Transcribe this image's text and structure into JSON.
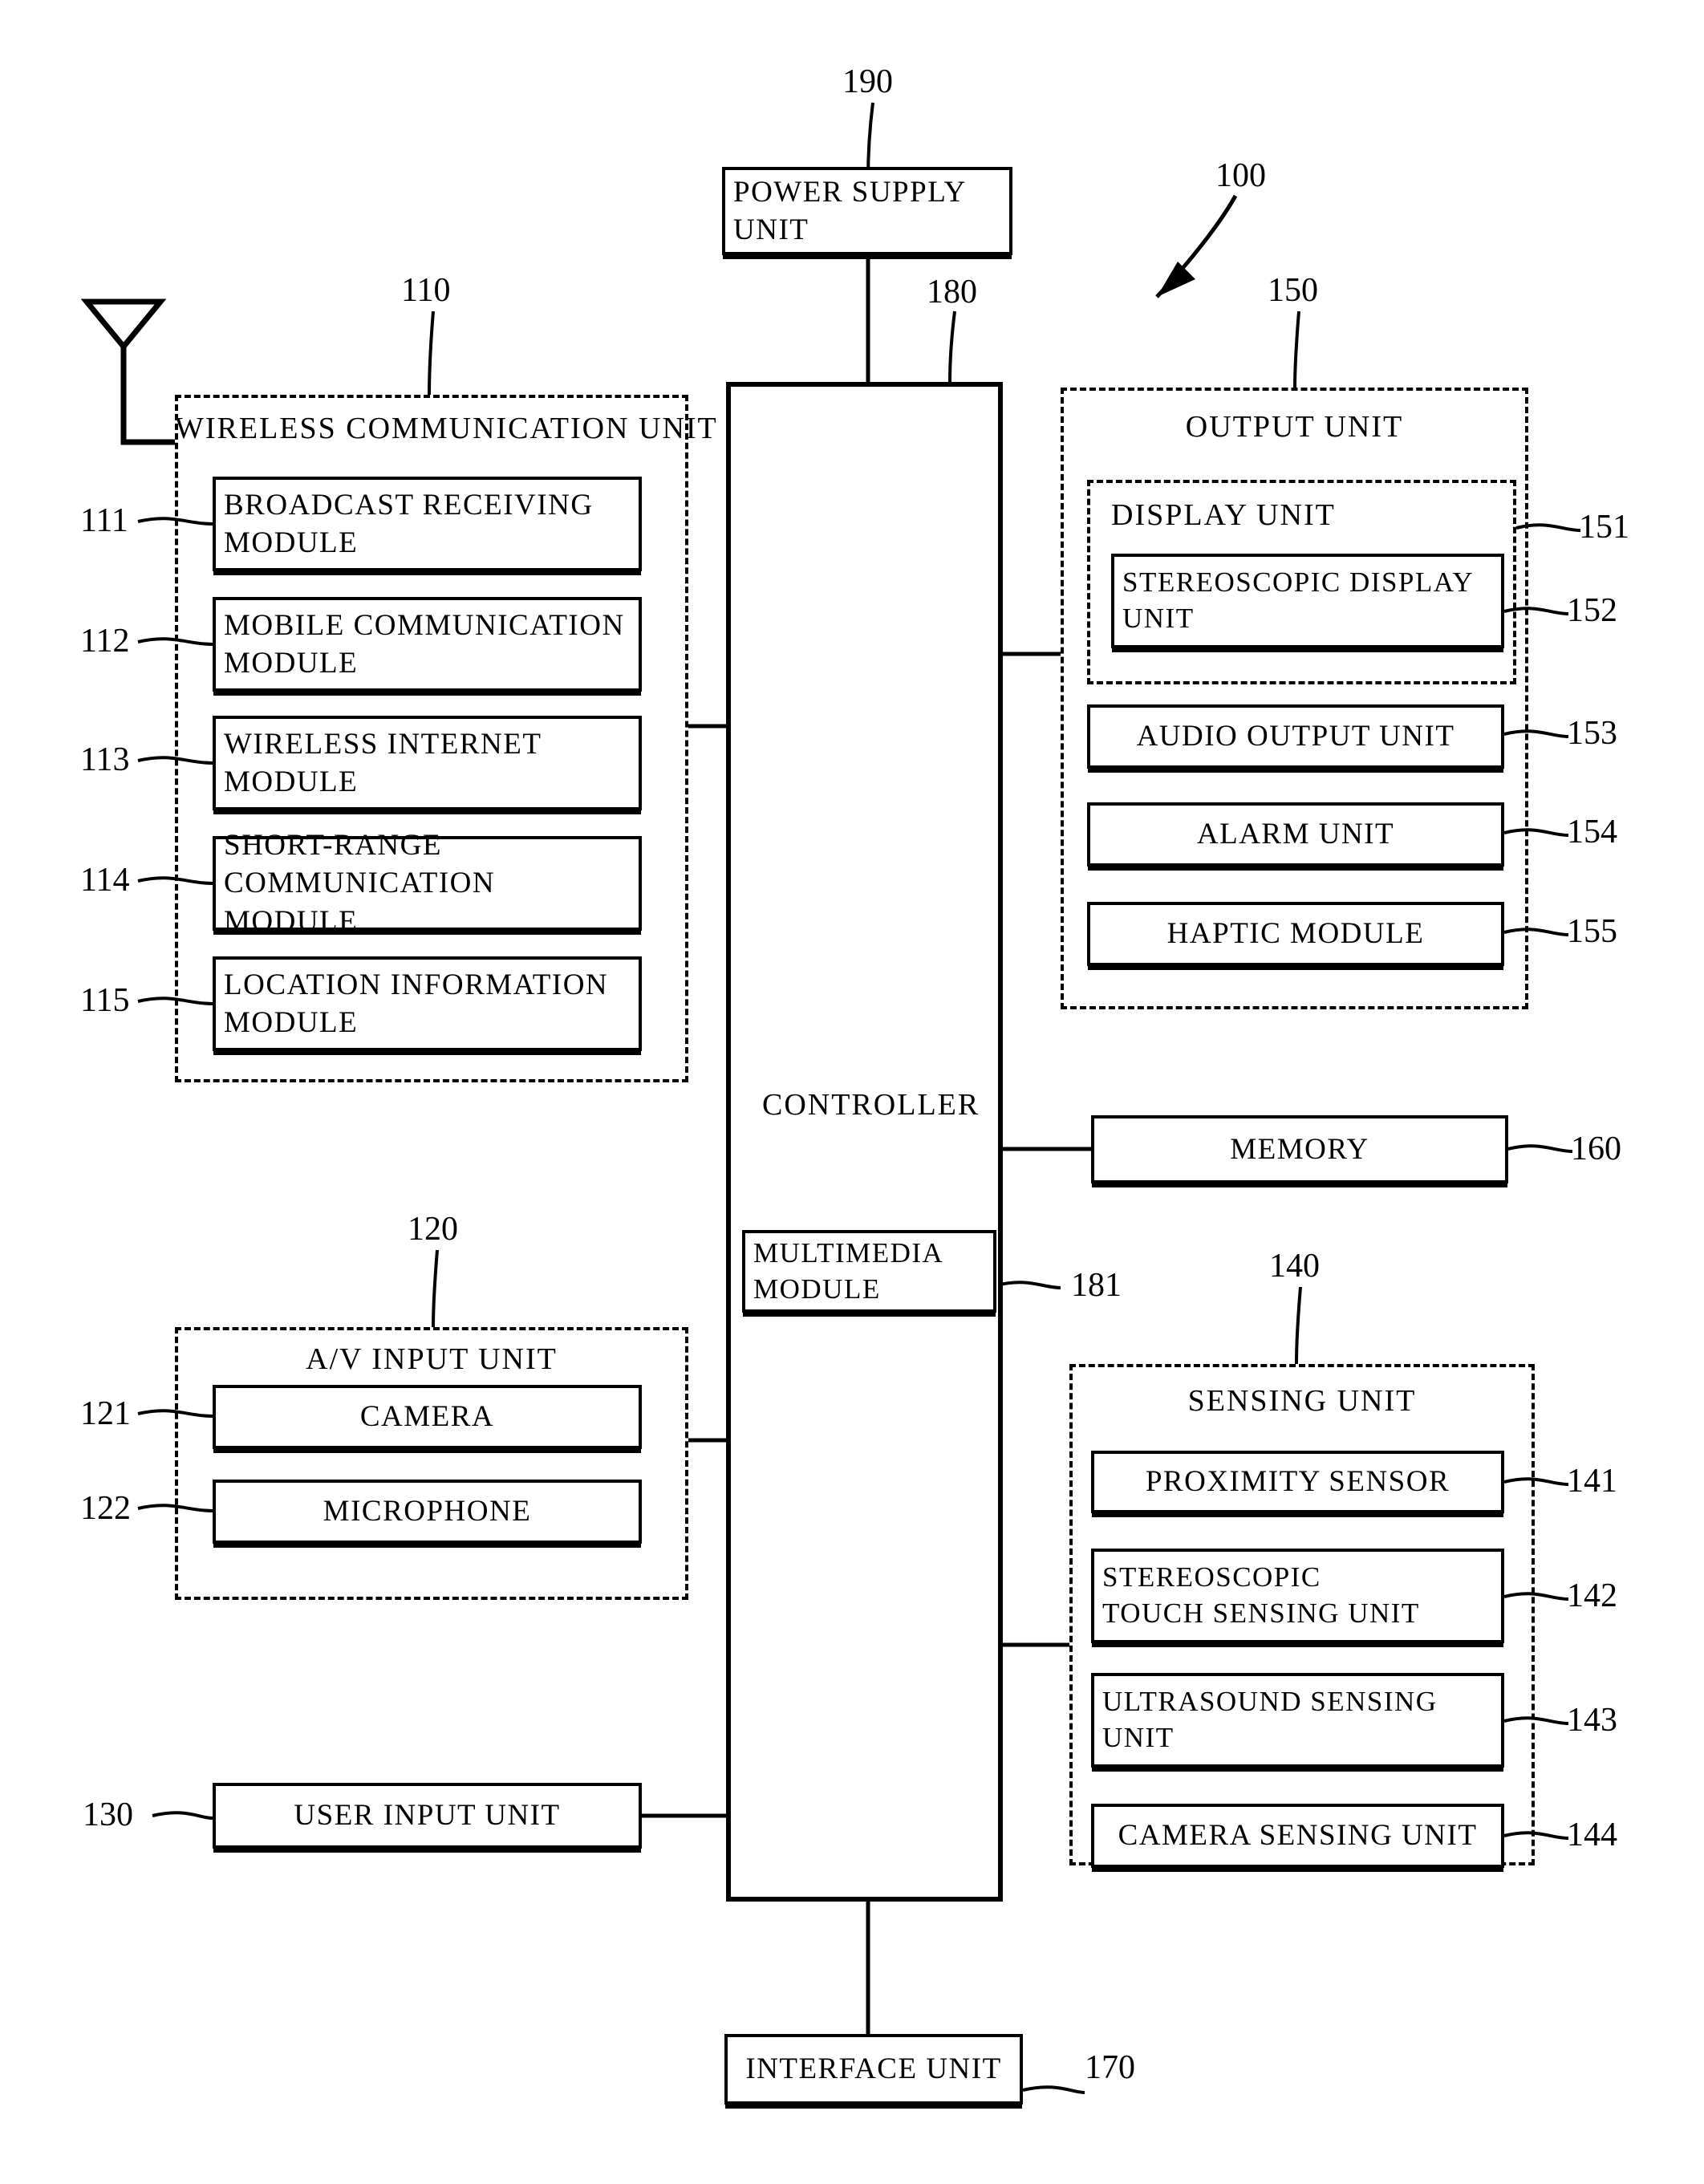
{
  "figure": {
    "type": "patent-block-diagram",
    "device_ref": "100"
  },
  "blocks": {
    "power_supply": {
      "label": "POWER SUPPLY\nUNIT",
      "ref": "190"
    },
    "controller": {
      "label": "CONTROLLER",
      "ref": "180"
    },
    "multimedia": {
      "label": "MULTIMEDIA\nMODULE",
      "ref": "181"
    },
    "memory": {
      "label": "MEMORY",
      "ref": "160"
    },
    "user_input": {
      "label": "USER INPUT UNIT",
      "ref": "130"
    },
    "interface": {
      "label": "INTERFACE UNIT",
      "ref": "170"
    }
  },
  "wireless_unit": {
    "title": "WIRELESS COMMUNICATION UNIT",
    "ref": "110",
    "modules": [
      {
        "label": "BROADCAST RECEIVING\nMODULE",
        "ref": "111"
      },
      {
        "label": "MOBILE COMMUNICATION\nMODULE",
        "ref": "112"
      },
      {
        "label": "WIRELESS INTERNET\nMODULE",
        "ref": "113"
      },
      {
        "label": "SHORT-RANGE\nCOMMUNICATION MODULE",
        "ref": "114"
      },
      {
        "label": "LOCATION INFORMATION\nMODULE",
        "ref": "115"
      }
    ]
  },
  "av_input_unit": {
    "title": "A/V INPUT UNIT",
    "ref": "120",
    "modules": [
      {
        "label": "CAMERA",
        "ref": "121"
      },
      {
        "label": "MICROPHONE",
        "ref": "122"
      }
    ]
  },
  "output_unit": {
    "title": "OUTPUT UNIT",
    "ref": "150",
    "display_unit": {
      "title": "DISPLAY UNIT",
      "ref": "151",
      "modules": [
        {
          "label": "STEREOSCOPIC DISPLAY\nUNIT",
          "ref": "152"
        }
      ]
    },
    "modules": [
      {
        "label": "AUDIO OUTPUT UNIT",
        "ref": "153"
      },
      {
        "label": "ALARM UNIT",
        "ref": "154"
      },
      {
        "label": "HAPTIC MODULE",
        "ref": "155"
      }
    ]
  },
  "sensing_unit": {
    "title": "SENSING UNIT",
    "ref": "140",
    "modules": [
      {
        "label": "PROXIMITY SENSOR",
        "ref": "141"
      },
      {
        "label": "STEREOSCOPIC\nTOUCH SENSING UNIT",
        "ref": "142"
      },
      {
        "label": "ULTRASOUND SENSING\nUNIT",
        "ref": "143"
      },
      {
        "label": "CAMERA SENSING UNIT",
        "ref": "144"
      }
    ]
  },
  "icons": {
    "antenna": "antenna-icon",
    "pointer": "arrow-pointer-icon"
  },
  "colors": {
    "ink": "#000000",
    "paper": "#ffffff"
  }
}
